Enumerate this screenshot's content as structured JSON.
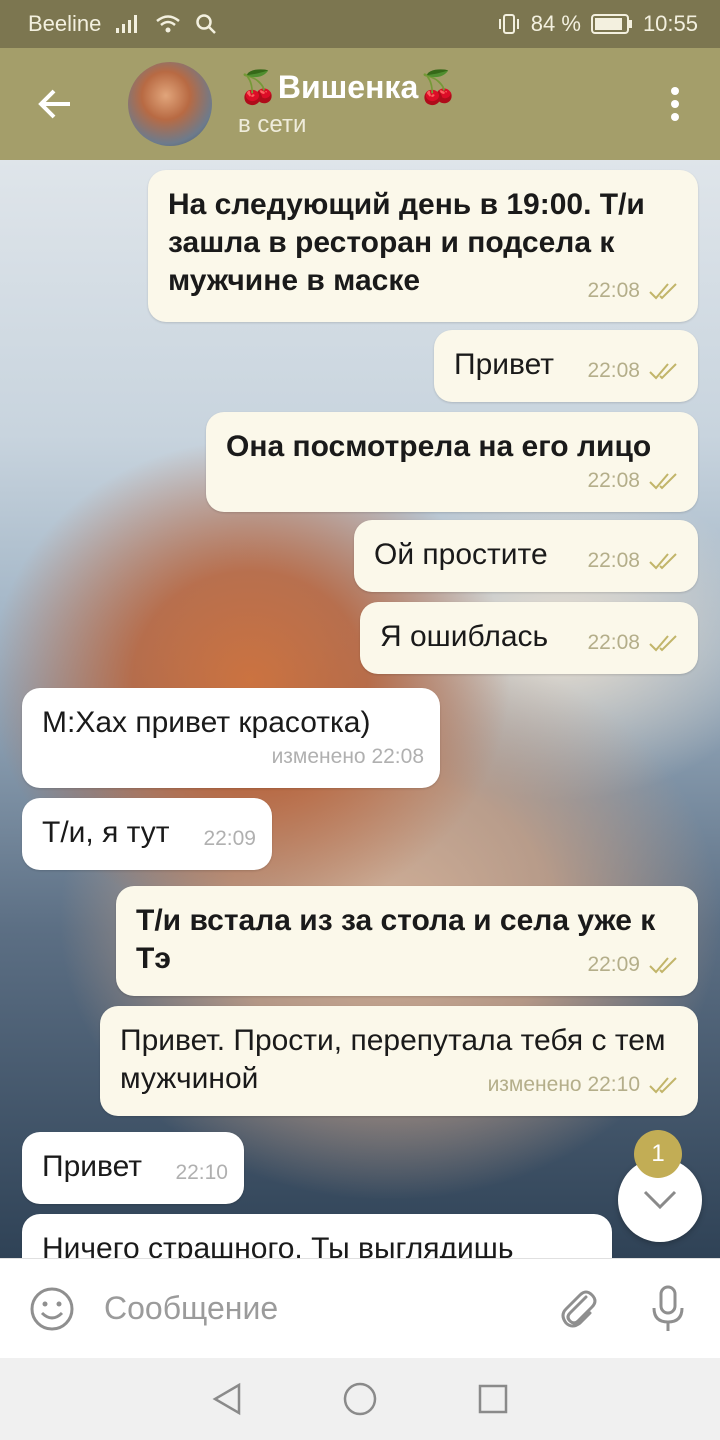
{
  "status_bar": {
    "carrier": "Beeline",
    "battery": "84 %",
    "time": "10:55"
  },
  "header": {
    "title": "🍒Вишенка🍒",
    "status": "в сети"
  },
  "messages": [
    {
      "dir": "out",
      "text": "На следующий день в 19:00. Т/и зашла в ресторан и подсела к мужчине в маске",
      "time": "22:08"
    },
    {
      "dir": "out",
      "text": "Привет",
      "time": "22:08"
    },
    {
      "dir": "out",
      "text": "Она посмотрела на его лицо",
      "time": "22:08"
    },
    {
      "dir": "out",
      "text": "Ой простите",
      "time": "22:08"
    },
    {
      "dir": "out",
      "text": "Я ошиблась",
      "time": "22:08"
    },
    {
      "dir": "in",
      "text": "М:Хах привет красотка)",
      "time": "изменено 22:08"
    },
    {
      "dir": "in",
      "text": "Т/и, я тут",
      "time": "22:09"
    },
    {
      "dir": "out",
      "text": "Т/и встала из за стола и села уже к Тэ",
      "time": "22:09"
    },
    {
      "dir": "out",
      "text": "Привет. Прости, перепутала тебя с тем мужчиной",
      "time": "изменено 22:10"
    },
    {
      "dir": "in",
      "text": "Привет",
      "time": "22:10"
    },
    {
      "dir": "in",
      "text": "Ничего страшного. Ты выглядишь",
      "time": ""
    }
  ],
  "unread_count": "1",
  "input": {
    "placeholder": "Сообщение"
  },
  "colors": {
    "header": "#a49e6a",
    "status_bar": "#7c7650",
    "outgoing_bubble": "#fbf8ea",
    "incoming_bubble": "#ffffff",
    "check_marks": "#c2b56a",
    "badge": "#c2ad55"
  },
  "icons": {
    "back": "arrow-left-icon",
    "menu": "more-vertical-icon",
    "emoji": "smiley-icon",
    "attach": "paperclip-icon",
    "mic": "microphone-icon",
    "scroll_down": "chevron-down-icon"
  }
}
